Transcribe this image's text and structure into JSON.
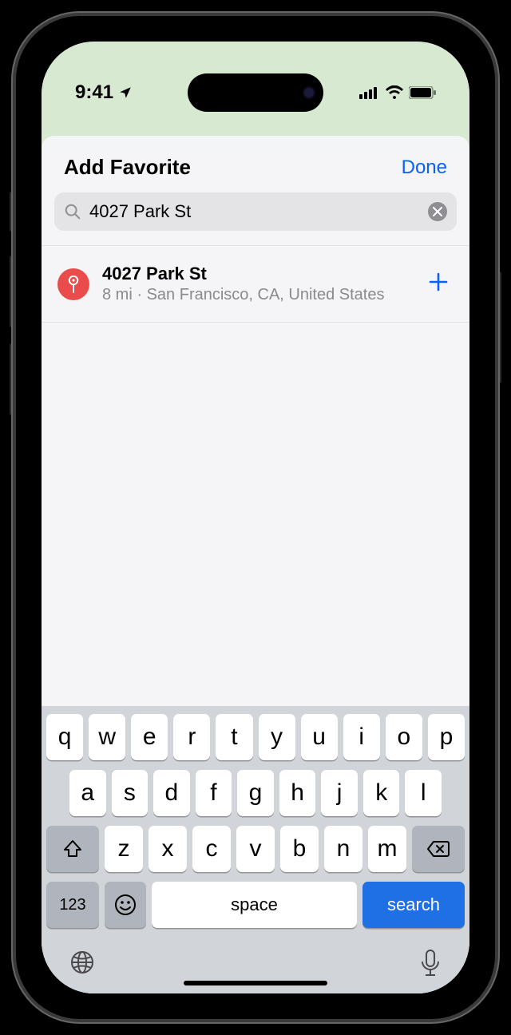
{
  "status": {
    "time": "9:41"
  },
  "sheet": {
    "title": "Add Favorite",
    "done": "Done"
  },
  "search": {
    "value": "4027 Park St"
  },
  "result": {
    "title": "4027 Park St",
    "distance": "8 mi",
    "location": "San Francisco, CA, United States"
  },
  "keyboard": {
    "row1": [
      "q",
      "w",
      "e",
      "r",
      "t",
      "y",
      "u",
      "i",
      "o",
      "p"
    ],
    "row2": [
      "a",
      "s",
      "d",
      "f",
      "g",
      "h",
      "j",
      "k",
      "l"
    ],
    "row3": [
      "z",
      "x",
      "c",
      "v",
      "b",
      "n",
      "m"
    ],
    "numkey": "123",
    "space": "space",
    "search": "search"
  }
}
